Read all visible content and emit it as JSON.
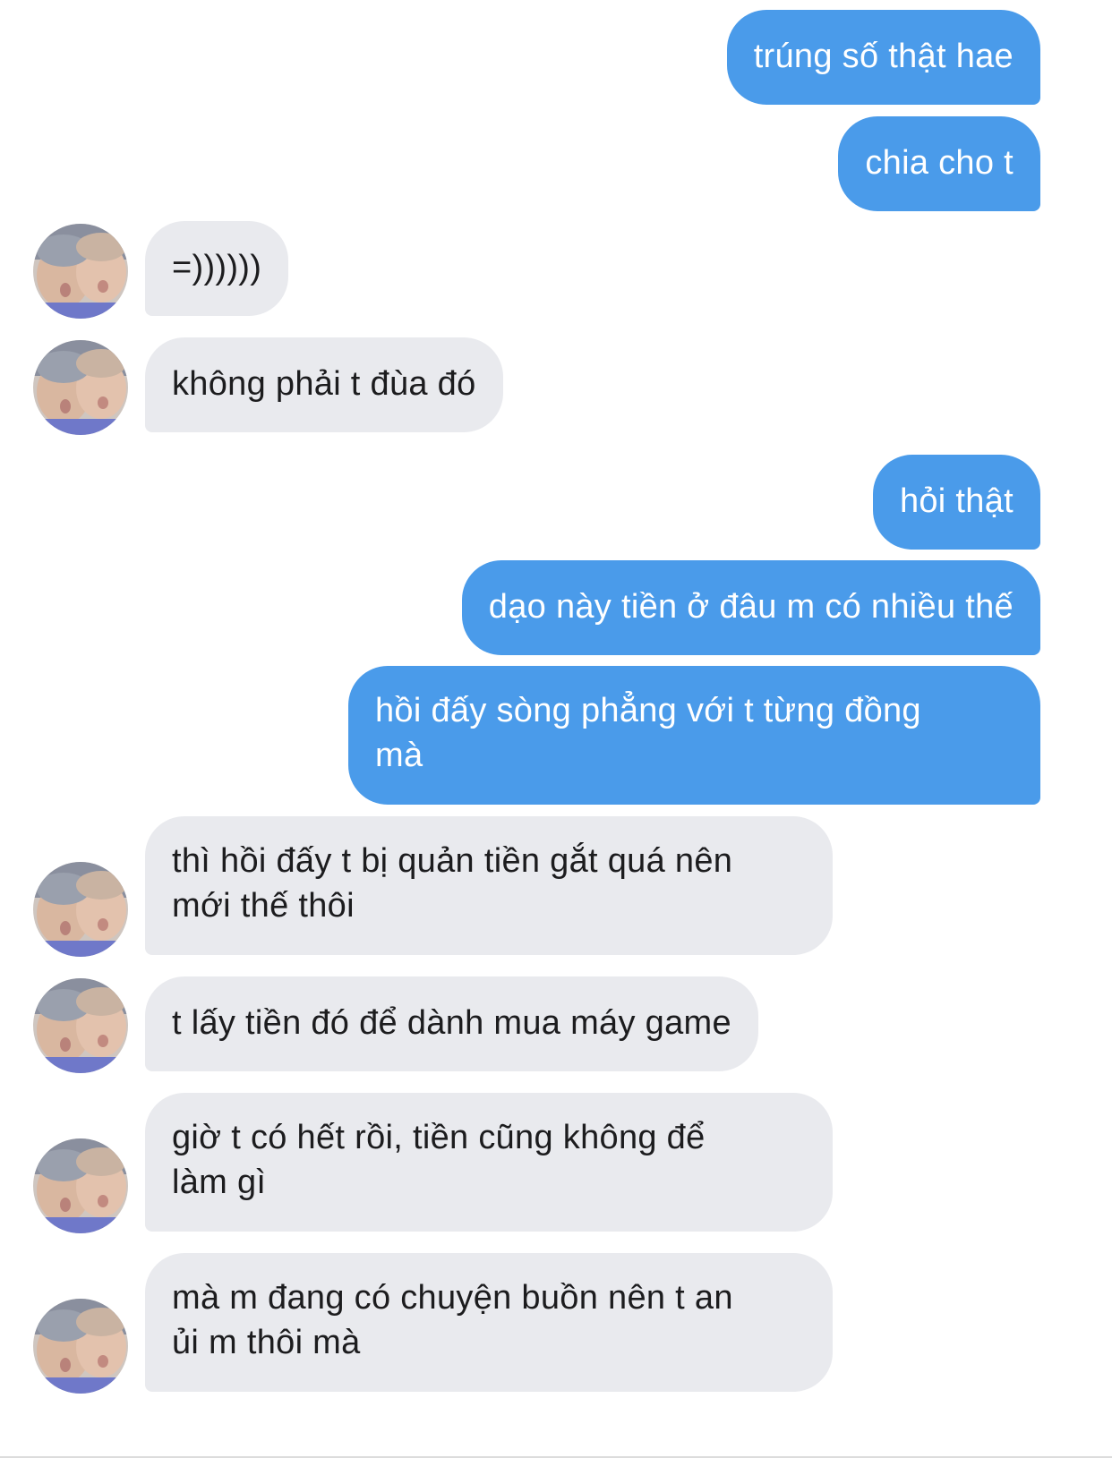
{
  "messages": [
    {
      "side": "out",
      "text": "trúng số thật hae"
    },
    {
      "side": "out",
      "text": "chia cho t"
    },
    {
      "side": "in",
      "text": "=))))))"
    },
    {
      "side": "in",
      "text": "không phải t đùa đó"
    },
    {
      "side": "out",
      "text": "hỏi thật"
    },
    {
      "side": "out",
      "text": "dạo này tiền ở đâu m có nhiều thế"
    },
    {
      "side": "out",
      "text": "hồi đấy sòng phẳng với t từng đồng\nmà"
    },
    {
      "side": "in",
      "text": "thì hồi đấy t bị quản tiền gắt quá nên\nmới thế thôi"
    },
    {
      "side": "in",
      "text": "t lấy tiền đó để dành mua máy game"
    },
    {
      "side": "in",
      "text": "giờ t có hết rồi, tiền cũng không để\nlàm gì"
    },
    {
      "side": "in",
      "text": "mà m đang có chuyện buồn nên t an\nủi m thôi mà"
    }
  ],
  "colors": {
    "outgoing_bubble": "#4a9bea",
    "incoming_bubble": "#e9eaee"
  },
  "icons": {
    "avatar": "contact-avatar-photo"
  }
}
